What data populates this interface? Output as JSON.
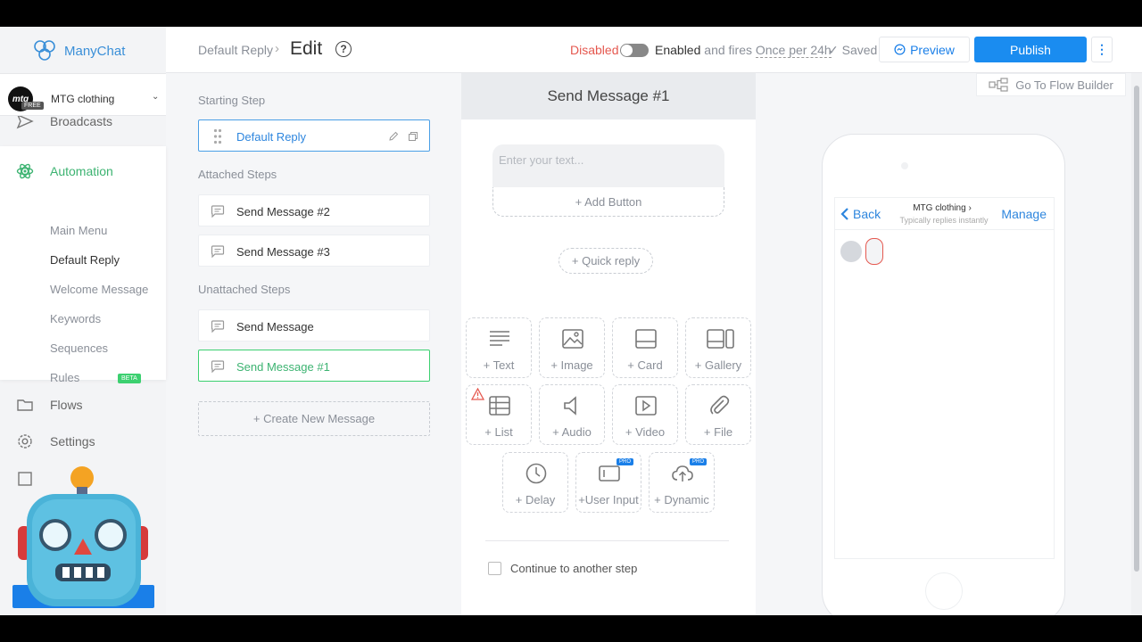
{
  "app": {
    "brand": "ManyChat"
  },
  "account": {
    "initials": "mtg",
    "plan_badge": "FREE",
    "name": "MTG clothing"
  },
  "sidebar": {
    "broadcasts": "Broadcasts",
    "automation": "Automation",
    "sub_items": [
      "Main Menu",
      "Default Reply",
      "Welcome Message",
      "Keywords",
      "Sequences",
      "Rules"
    ],
    "beta_badge": "BETA",
    "flows": "Flows",
    "settings": "Settings"
  },
  "header": {
    "breadcrumb_parent": "Default Reply",
    "breadcrumb_separator": "›",
    "breadcrumb_current": "Edit",
    "help": "?",
    "status_disabled": "Disabled",
    "status_enabled": "Enabled",
    "status_and_fires": "and fires",
    "status_frequency": "Once per 24h",
    "saved": "Saved",
    "preview": "Preview",
    "publish": "Publish",
    "more": "⋮"
  },
  "steps": {
    "starting_label": "Starting Step",
    "starting_step": "Default Reply",
    "attached_label": "Attached Steps",
    "attached": [
      "Send Message #2",
      "Send Message #3"
    ],
    "unattached_label": "Unattached Steps",
    "unattached": [
      "Send Message",
      "Send Message #1"
    ],
    "create_new": "+ Create New Message"
  },
  "editor": {
    "title": "Send Message #1",
    "text_placeholder": "Enter your text...",
    "add_button": "+ Add Button",
    "quick_reply": "+ Quick reply",
    "tiles": {
      "text": "+ Text",
      "image": "+ Image",
      "card": "+ Card",
      "gallery": "+ Gallery",
      "list": "+ List",
      "audio": "+ Audio",
      "video": "+ Video",
      "file": "+ File",
      "delay": "+ Delay",
      "user_input": "+User Input",
      "dynamic": "+ Dynamic"
    },
    "pro_badge": "PRO",
    "continue_label": "Continue to another step"
  },
  "preview": {
    "flow_builder": "Go To Flow Builder",
    "back": "Back",
    "page_name": "MTG clothing",
    "page_chevron": "›",
    "reply_time": "Typically replies instantly",
    "manage": "Manage"
  },
  "colors": {
    "accent_blue": "#1a8cf0",
    "automation_green": "#3cb371",
    "disabled_red": "#e5584f"
  }
}
